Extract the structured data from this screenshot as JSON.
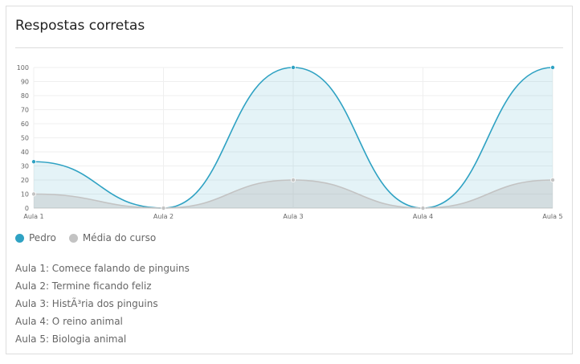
{
  "card": {
    "title": "Respostas corretas"
  },
  "legend": [
    {
      "label": "Pedro",
      "color": "#2fa2c3"
    },
    {
      "label": "Média do curso",
      "color": "#c3c3c3"
    }
  ],
  "lessons": [
    "Aula 1: Comece falando de pinguins",
    "Aula 2: Termine ficando feliz",
    "Aula 3: HistÃ³ria dos pinguins",
    "Aula 4: O reino animal",
    "Aula 5: Biologia animal"
  ],
  "chart_data": {
    "type": "line",
    "categories": [
      "Aula 1",
      "Aula 2",
      "Aula 3",
      "Aula 4",
      "Aula 5"
    ],
    "y_ticks": [
      0,
      10,
      20,
      30,
      40,
      50,
      60,
      70,
      80,
      90,
      100
    ],
    "ylim": [
      0,
      100
    ],
    "grid": true,
    "legend_position": "bottom-left",
    "series": [
      {
        "name": "Pedro",
        "values": [
          33,
          0,
          100,
          0,
          100
        ],
        "color": "#2fa2c3",
        "fill": "rgba(47,162,195,0.13)"
      },
      {
        "name": "Média do curso",
        "values": [
          10,
          0,
          20,
          0,
          20
        ],
        "color": "#c3c3c3",
        "fill": "rgba(180,180,180,0.35)"
      }
    ]
  }
}
